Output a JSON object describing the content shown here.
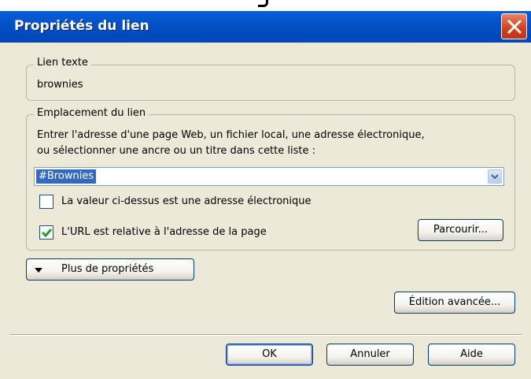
{
  "window": {
    "title": "Propriétés du lien"
  },
  "link_text_group": {
    "legend": "Lien texte",
    "value": "brownies"
  },
  "link_location_group": {
    "legend": "Emplacement du lien",
    "instructions_line1": "Entrer l'adresse d'une page Web, un fichier local, une adresse électronique,",
    "instructions_line2": "ou sélectionner une ancre ou un titre dans cette liste :",
    "url_value": "#Brownies",
    "email_checkbox": {
      "label": "La valeur ci-dessus est une adresse électronique",
      "checked": false
    },
    "relative_checkbox": {
      "label": "L'URL est relative à l'adresse de la page",
      "checked": true
    },
    "browse_button": "Parcourir..."
  },
  "more_properties_button": "Plus de propriétés",
  "advanced_edit_button": "Édition avancée...",
  "footer": {
    "ok": "OK",
    "cancel": "Annuler",
    "help": "Aide"
  },
  "colors": {
    "titlebar": "#0351c8",
    "dialog_bg": "#ece9d8",
    "close": "#d2401b",
    "selection": "#316ac5"
  }
}
